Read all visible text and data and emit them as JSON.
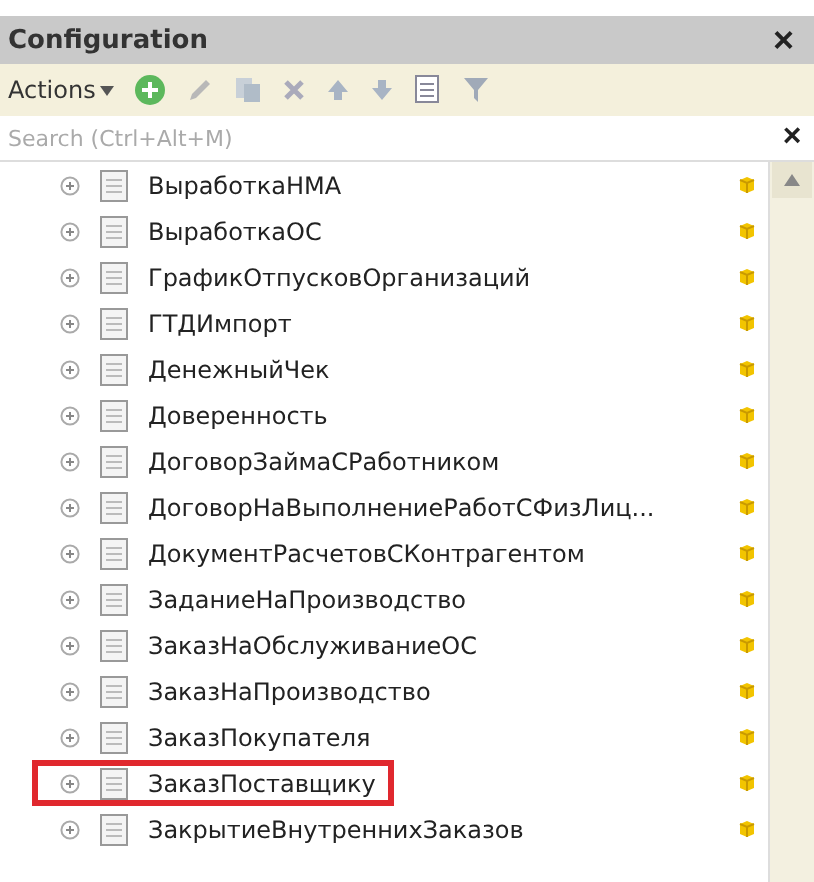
{
  "window": {
    "title": "Configuration",
    "close": "×"
  },
  "toolbar": {
    "actions": "Actions"
  },
  "search": {
    "placeholder": "Search (Ctrl+Alt+M)",
    "clear": "×"
  },
  "rows": [
    {
      "label": "ВыработкаНМА",
      "highlighted": false
    },
    {
      "label": "ВыработкаОС",
      "highlighted": false
    },
    {
      "label": "ГрафикОтпусковОрганизаций",
      "highlighted": false
    },
    {
      "label": "ГТДИмпорт",
      "highlighted": false
    },
    {
      "label": "ДенежныйЧек",
      "highlighted": false
    },
    {
      "label": "Доверенность",
      "highlighted": false
    },
    {
      "label": "ДоговорЗаймаСРаботником",
      "highlighted": false
    },
    {
      "label": "ДоговорНаВыполнениеРаботСФизЛиц...",
      "highlighted": false
    },
    {
      "label": "ДокументРасчетовСКонтрагентом",
      "highlighted": false
    },
    {
      "label": "ЗаданиеНаПроизводство",
      "highlighted": false
    },
    {
      "label": "ЗаказНаОбслуживаниеОС",
      "highlighted": false
    },
    {
      "label": "ЗаказНаПроизводство",
      "highlighted": false
    },
    {
      "label": "ЗаказПокупателя",
      "highlighted": false
    },
    {
      "label": "ЗаказПоставщику",
      "highlighted": true
    },
    {
      "label": "ЗакрытиеВнутреннихЗаказов",
      "highlighted": false
    }
  ]
}
